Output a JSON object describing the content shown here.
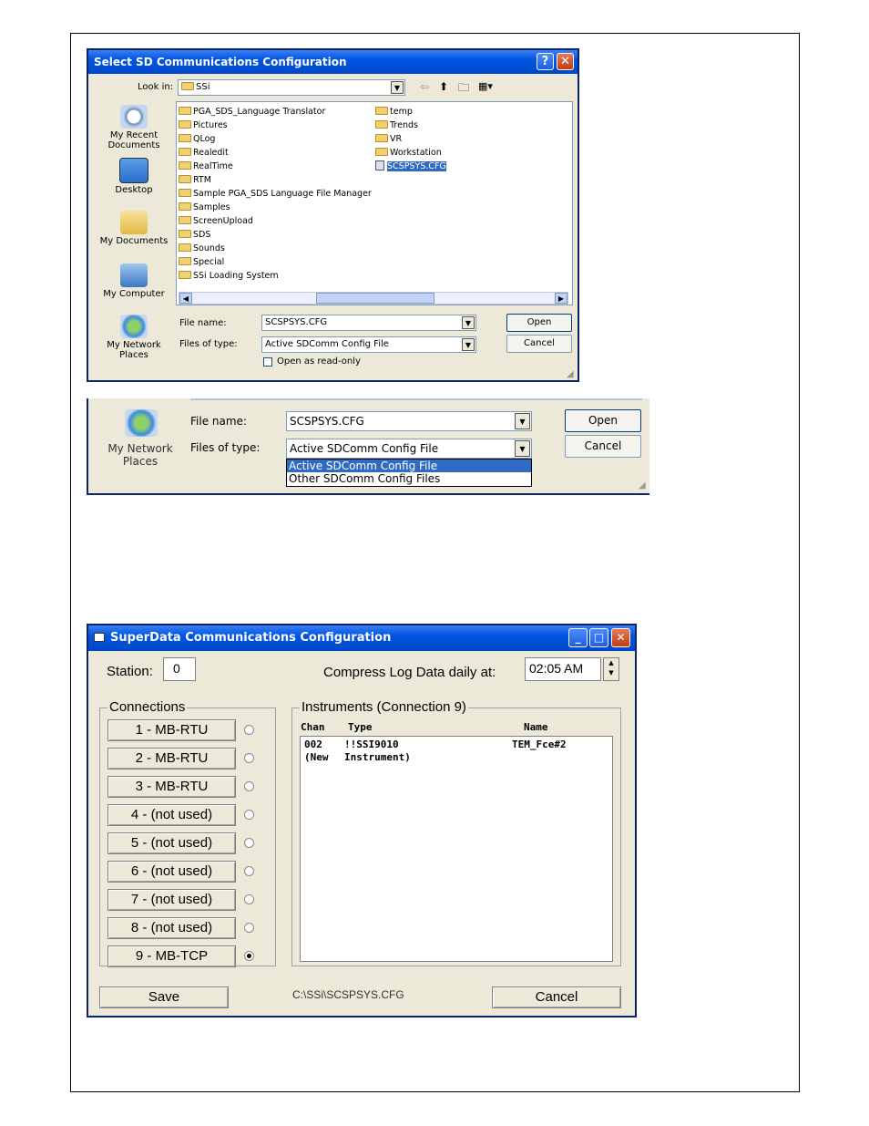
{
  "open_dialog": {
    "title": "Select SD Communications Configuration",
    "look_in_label": "Look in:",
    "look_in_value": "SSi",
    "places": [
      "My Recent Documents",
      "Desktop",
      "My Documents",
      "My Computer",
      "My Network Places"
    ],
    "files_col1": [
      "PGA_SDS_Language Translator",
      "Pictures",
      "QLog",
      "Realedit",
      "RealTime",
      "RTM",
      "Sample PGA_SDS Language File Manager",
      "Samples",
      "ScreenUpload",
      "SDS",
      "Sounds",
      "Special",
      "SSi Loading System"
    ],
    "files_col2": [
      "temp",
      "Trends",
      "VR",
      "Workstation"
    ],
    "selected_file": "SCSPSYS.CFG",
    "file_name_label": "File name:",
    "file_name_value": "SCSPSYS.CFG",
    "files_of_type_label": "Files of type:",
    "files_of_type_value": "Active SDComm Config File",
    "open_label": "Open",
    "cancel_label": "Cancel",
    "readonly_label": "Open as read-only"
  },
  "crop_dialog": {
    "place": "My Network Places",
    "file_name_label": "File name:",
    "file_name_value": "SCSPSYS.CFG",
    "files_of_type_label": "Files of type:",
    "files_of_type_value": "Active SDComm Config File",
    "open_label": "Open",
    "cancel_label": "Cancel",
    "dropdown_options": [
      "Active SDComm Config File",
      "Other SDComm Config Files"
    ]
  },
  "config_form": {
    "title": "SuperData Communications Configuration",
    "station_label": "Station:",
    "station_value": "0",
    "compress_label": "Compress Log Data daily at:",
    "compress_time": "02:05 AM",
    "connections_legend": "Connections",
    "connections": [
      "1 - MB-RTU",
      "2 - MB-RTU",
      "3 - MB-RTU",
      "4 - (not used)",
      "5 - (not used)",
      "6 - (not used)",
      "7 - (not used)",
      "8 - (not used)",
      "9 - MB-TCP"
    ],
    "selected_connection": 9,
    "instruments_legend": "Instruments (Connection 9)",
    "col_chan": "Chan",
    "col_type": "Type",
    "col_name": "Name",
    "instrument_rows": [
      {
        "chan": "002",
        "type": "!!SSI9010",
        "name": "TEM_Fce#2"
      },
      {
        "chan": "(New",
        "type": "Instrument)",
        "name": ""
      }
    ],
    "save_label": "Save",
    "path": "C:\\SSi\\SCSPSYS.CFG",
    "cancel_label": "Cancel"
  }
}
